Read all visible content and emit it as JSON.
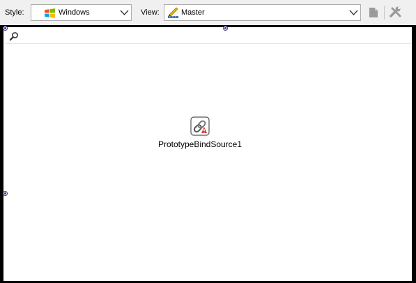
{
  "toolbar": {
    "style_label": "Style:",
    "style_value": "Windows",
    "style_icon": "windows-flag-icon",
    "view_label": "View:",
    "view_value": "Master",
    "view_icon": "pencil-ruler-icon",
    "buttons": [
      "page-icon",
      "wrench-icon"
    ]
  },
  "search": {
    "icon": "search-icon",
    "placeholder": ""
  },
  "component": {
    "name": "PrototypeBindSource1",
    "icon": "chain-link-icon"
  },
  "colors": {
    "canvas_background": "#ffffff",
    "designer_border": "#000000",
    "toolbar_background": "#f0f0f0",
    "handle": "#3a3a7a"
  }
}
